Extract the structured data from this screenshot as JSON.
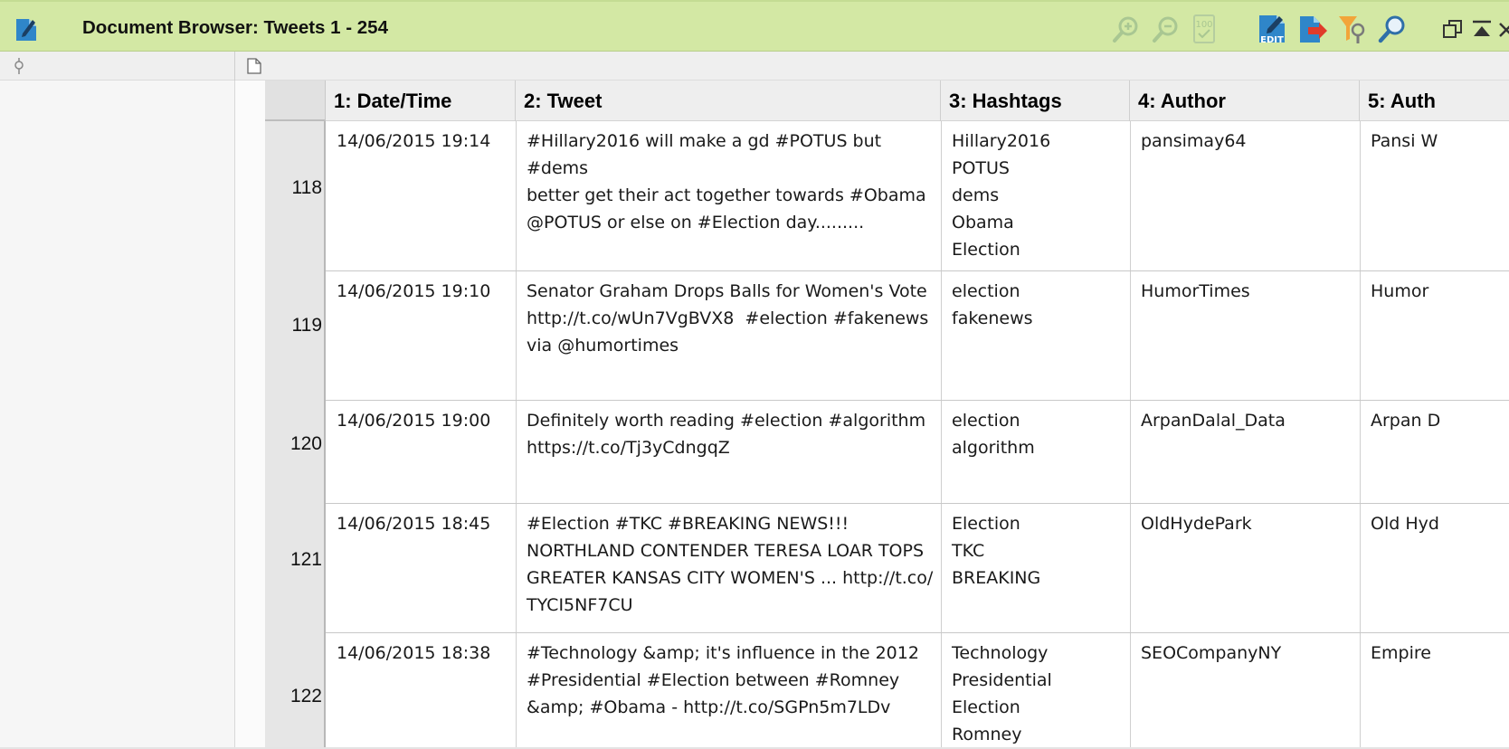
{
  "window": {
    "title": "Document Browser: Tweets 1 - 254"
  },
  "toolbar": {
    "icons": [
      "zoom-in-icon",
      "zoom-out-icon",
      "zoom-100-icon",
      "edit-icon",
      "export-icon",
      "filter-icon",
      "search-icon",
      "restore-window-icon",
      "collapse-icon",
      "close-icon"
    ],
    "zoom_100_label": "100",
    "edit_label": "EDIT"
  },
  "grid": {
    "columns": [
      "1: Date/Time",
      "2: Tweet",
      "3: Hashtags",
      "4: Author",
      "5: Auth"
    ],
    "rows": [
      {
        "num": "118",
        "datetime": "14/06/2015 19:14",
        "tweet": "#Hillary2016 will make a gd #POTUS but #dems\nbetter get their act together towards #Obama\n@POTUS or else on #Election day.........",
        "hashtags": [
          "Hillary2016",
          "POTUS",
          "dems",
          "Obama",
          "Election"
        ],
        "author": "pansimay64",
        "author_name": "Pansi W"
      },
      {
        "num": "119",
        "datetime": "14/06/2015 19:10",
        "tweet": "Senator Graham Drops Balls for Women's Vote\nhttp://t.co/wUn7VgBVX8  #election #fakenews\nvia @humortimes",
        "hashtags": [
          "election",
          "fakenews"
        ],
        "author": "HumorTimes",
        "author_name": "Humor"
      },
      {
        "num": "120",
        "datetime": "14/06/2015 19:00",
        "tweet": "Definitely worth reading #election #algorithm\nhttps://t.co/Tj3yCdngqZ",
        "hashtags": [
          "election",
          "algorithm"
        ],
        "author": "ArpanDalal_Data",
        "author_name": "Arpan D"
      },
      {
        "num": "121",
        "datetime": "14/06/2015 18:45",
        "tweet": "#Election #TKC #BREAKING NEWS!!!\nNORTHLAND CONTENDER TERESA LOAR TOPS\nGREATER KANSAS CITY WOMEN'S ... http://t.co/\nTYCI5NF7CU",
        "hashtags": [
          "Election",
          "TKC",
          "BREAKING"
        ],
        "author": "OldHydePark",
        "author_name": "Old Hyd"
      },
      {
        "num": "122",
        "datetime": "14/06/2015 18:38",
        "tweet": "#Technology &amp; it's influence in the 2012\n#Presidential #Election between #Romney\n&amp; #Obama - http://t.co/SGPn5m7LDv",
        "hashtags": [
          "Technology",
          "Presidential",
          "Election",
          "Romney"
        ],
        "author": "SEOCompanyNY",
        "author_name": "Empire"
      }
    ]
  }
}
